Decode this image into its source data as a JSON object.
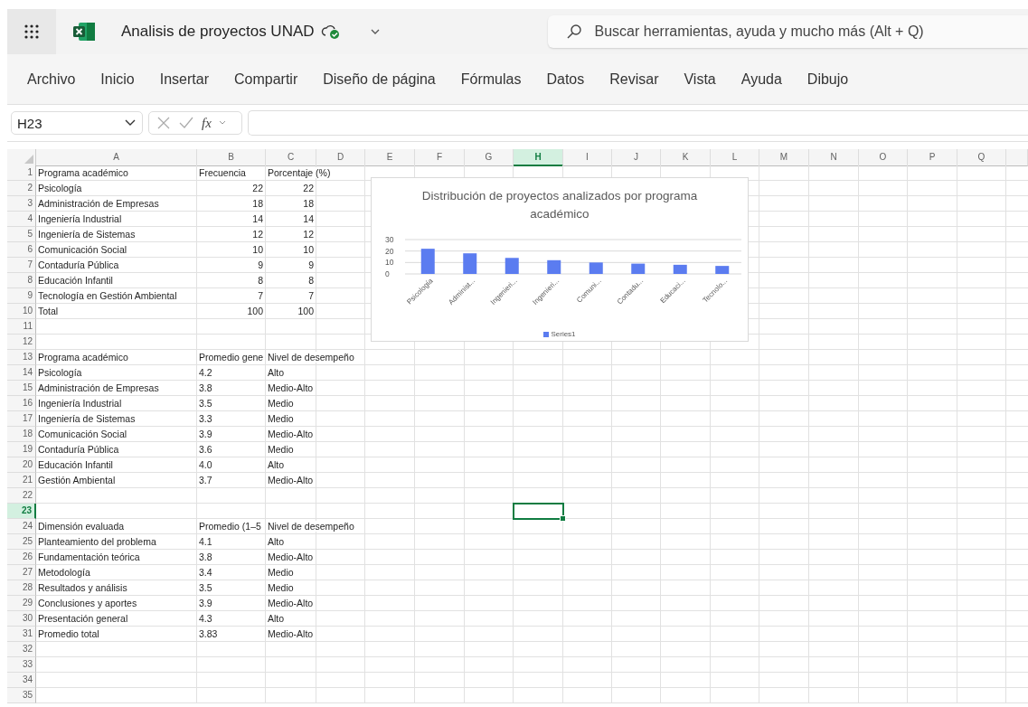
{
  "titlebar": {
    "title": "Analisis de proyectos UNAD",
    "search": {
      "placeholder": "Buscar herramientas, ayuda y mucho más (Alt + Q)"
    }
  },
  "menu": [
    "Archivo",
    "Inicio",
    "Insertar",
    "Compartir",
    "Diseño de página",
    "Fórmulas",
    "Datos",
    "Revisar",
    "Vista",
    "Ayuda",
    "Dibujo"
  ],
  "formula_bar": {
    "name_box": "H23",
    "function_label": "fx"
  },
  "sheet": {
    "columns": [
      {
        "label": "A",
        "selected": false
      },
      {
        "label": "B",
        "selected": false
      },
      {
        "label": "C",
        "selected": false
      },
      {
        "label": "D",
        "selected": false
      },
      {
        "label": "E",
        "selected": false
      },
      {
        "label": "F",
        "selected": false
      },
      {
        "label": "G",
        "selected": false
      },
      {
        "label": "H",
        "selected": true
      },
      {
        "label": "I",
        "selected": false
      },
      {
        "label": "J",
        "selected": false
      },
      {
        "label": "K",
        "selected": false
      },
      {
        "label": "L",
        "selected": false
      },
      {
        "label": "M",
        "selected": false
      },
      {
        "label": "N",
        "selected": false
      },
      {
        "label": "O",
        "selected": false
      },
      {
        "label": "P",
        "selected": false
      },
      {
        "label": "Q",
        "selected": false
      }
    ],
    "rows": [
      {
        "number": "1",
        "selected": false,
        "kind": "text",
        "cells": [
          "Programa académico",
          "Frecuencia",
          "Porcentaje (%)"
        ]
      },
      {
        "number": "2",
        "selected": false,
        "kind": "number",
        "cells": [
          "Psicología",
          "22",
          "22"
        ]
      },
      {
        "number": "3",
        "selected": false,
        "kind": "number",
        "cells": [
          "Administración de Empresas",
          "18",
          "18"
        ]
      },
      {
        "number": "4",
        "selected": false,
        "kind": "number",
        "cells": [
          "Ingeniería Industrial",
          "14",
          "14"
        ]
      },
      {
        "number": "5",
        "selected": false,
        "kind": "number",
        "cells": [
          "Ingeniería de Sistemas",
          "12",
          "12"
        ]
      },
      {
        "number": "6",
        "selected": false,
        "kind": "number",
        "cells": [
          "Comunicación Social",
          "10",
          "10"
        ]
      },
      {
        "number": "7",
        "selected": false,
        "kind": "number",
        "cells": [
          "Contaduría Pública",
          "9",
          "9"
        ]
      },
      {
        "number": "8",
        "selected": false,
        "kind": "number",
        "cells": [
          "Educación Infantil",
          "8",
          "8"
        ]
      },
      {
        "number": "9",
        "selected": false,
        "kind": "number",
        "cells": [
          "Tecnología en Gestión Ambiental",
          "7",
          "7"
        ]
      },
      {
        "number": "10",
        "selected": false,
        "kind": "number",
        "cells": [
          "Total",
          "100",
          "100"
        ]
      },
      {
        "number": "11",
        "selected": false,
        "kind": "text",
        "cells": []
      },
      {
        "number": "12",
        "selected": false,
        "kind": "text",
        "cells": []
      },
      {
        "number": "13",
        "selected": false,
        "kind": "text",
        "cells": [
          "Programa académico",
          "Promedio gene",
          "Nivel de desempeño"
        ]
      },
      {
        "number": "14",
        "selected": false,
        "kind": "text",
        "cells": [
          "Psicología",
          "4.2",
          "Alto"
        ]
      },
      {
        "number": "15",
        "selected": false,
        "kind": "text",
        "cells": [
          "Administración de Empresas",
          "3.8",
          "Medio-Alto"
        ]
      },
      {
        "number": "16",
        "selected": false,
        "kind": "text",
        "cells": [
          "Ingeniería Industrial",
          "3.5",
          "Medio"
        ]
      },
      {
        "number": "17",
        "selected": false,
        "kind": "text",
        "cells": [
          "Ingeniería de Sistemas",
          "3.3",
          "Medio"
        ]
      },
      {
        "number": "18",
        "selected": false,
        "kind": "text",
        "cells": [
          "Comunicación Social",
          "3.9",
          "Medio-Alto"
        ]
      },
      {
        "number": "19",
        "selected": false,
        "kind": "text",
        "cells": [
          "Contaduría Pública",
          "3.6",
          "Medio"
        ]
      },
      {
        "number": "20",
        "selected": false,
        "kind": "text",
        "cells": [
          "Educación Infantil",
          "4.0",
          "Alto"
        ]
      },
      {
        "number": "21",
        "selected": false,
        "kind": "text",
        "cells": [
          "Gestión Ambiental",
          "3.7",
          "Medio-Alto"
        ]
      },
      {
        "number": "22",
        "selected": false,
        "kind": "text",
        "cells": []
      },
      {
        "number": "23",
        "selected": true,
        "kind": "text",
        "cells": []
      },
      {
        "number": "24",
        "selected": false,
        "kind": "text",
        "cells": [
          "Dimensión evaluada",
          "Promedio (1–5",
          "Nivel de desempeño"
        ]
      },
      {
        "number": "25",
        "selected": false,
        "kind": "text",
        "cells": [
          "Planteamiento del problema",
          "4.1",
          "Alto"
        ]
      },
      {
        "number": "26",
        "selected": false,
        "kind": "text",
        "cells": [
          "Fundamentación teórica",
          "3.8",
          "Medio-Alto"
        ]
      },
      {
        "number": "27",
        "selected": false,
        "kind": "text",
        "cells": [
          "Metodología",
          "3.4",
          "Medio"
        ]
      },
      {
        "number": "28",
        "selected": false,
        "kind": "text",
        "cells": [
          "Resultados y análisis",
          "3.5",
          "Medio"
        ]
      },
      {
        "number": "29",
        "selected": false,
        "kind": "text",
        "cells": [
          "Conclusiones y aportes",
          "3.9",
          "Medio-Alto"
        ]
      },
      {
        "number": "30",
        "selected": false,
        "kind": "text",
        "cells": [
          "Presentación general",
          "4.3",
          "Alto"
        ]
      },
      {
        "number": "31",
        "selected": false,
        "kind": "text",
        "cells": [
          "Promedio total",
          "3.83",
          "Medio-Alto"
        ]
      },
      {
        "number": "32",
        "selected": false,
        "kind": "text",
        "cells": []
      },
      {
        "number": "33",
        "selected": false,
        "kind": "text",
        "cells": []
      },
      {
        "number": "34",
        "selected": false,
        "kind": "text",
        "cells": []
      },
      {
        "number": "35",
        "selected": false,
        "kind": "text",
        "cells": []
      }
    ],
    "chart": {
      "chart_data": {
        "type": "bar",
        "title": "Distribución de proyectos analizados por programa académico",
        "categories": [
          "Psicología",
          "Administ...",
          "Ingenieri...",
          "Ingenieri...",
          "Comuni...",
          "Contadu...",
          "Educaci...",
          "Tecnolo..."
        ],
        "series": [
          {
            "name": "Series1",
            "color": "#5b7cf0",
            "values": [
              22,
              18,
              14,
              12,
              10,
              9,
              8,
              7
            ]
          }
        ],
        "ylim": [
          0,
          30
        ],
        "yticks": [
          0,
          10,
          20,
          30
        ]
      }
    }
  }
}
